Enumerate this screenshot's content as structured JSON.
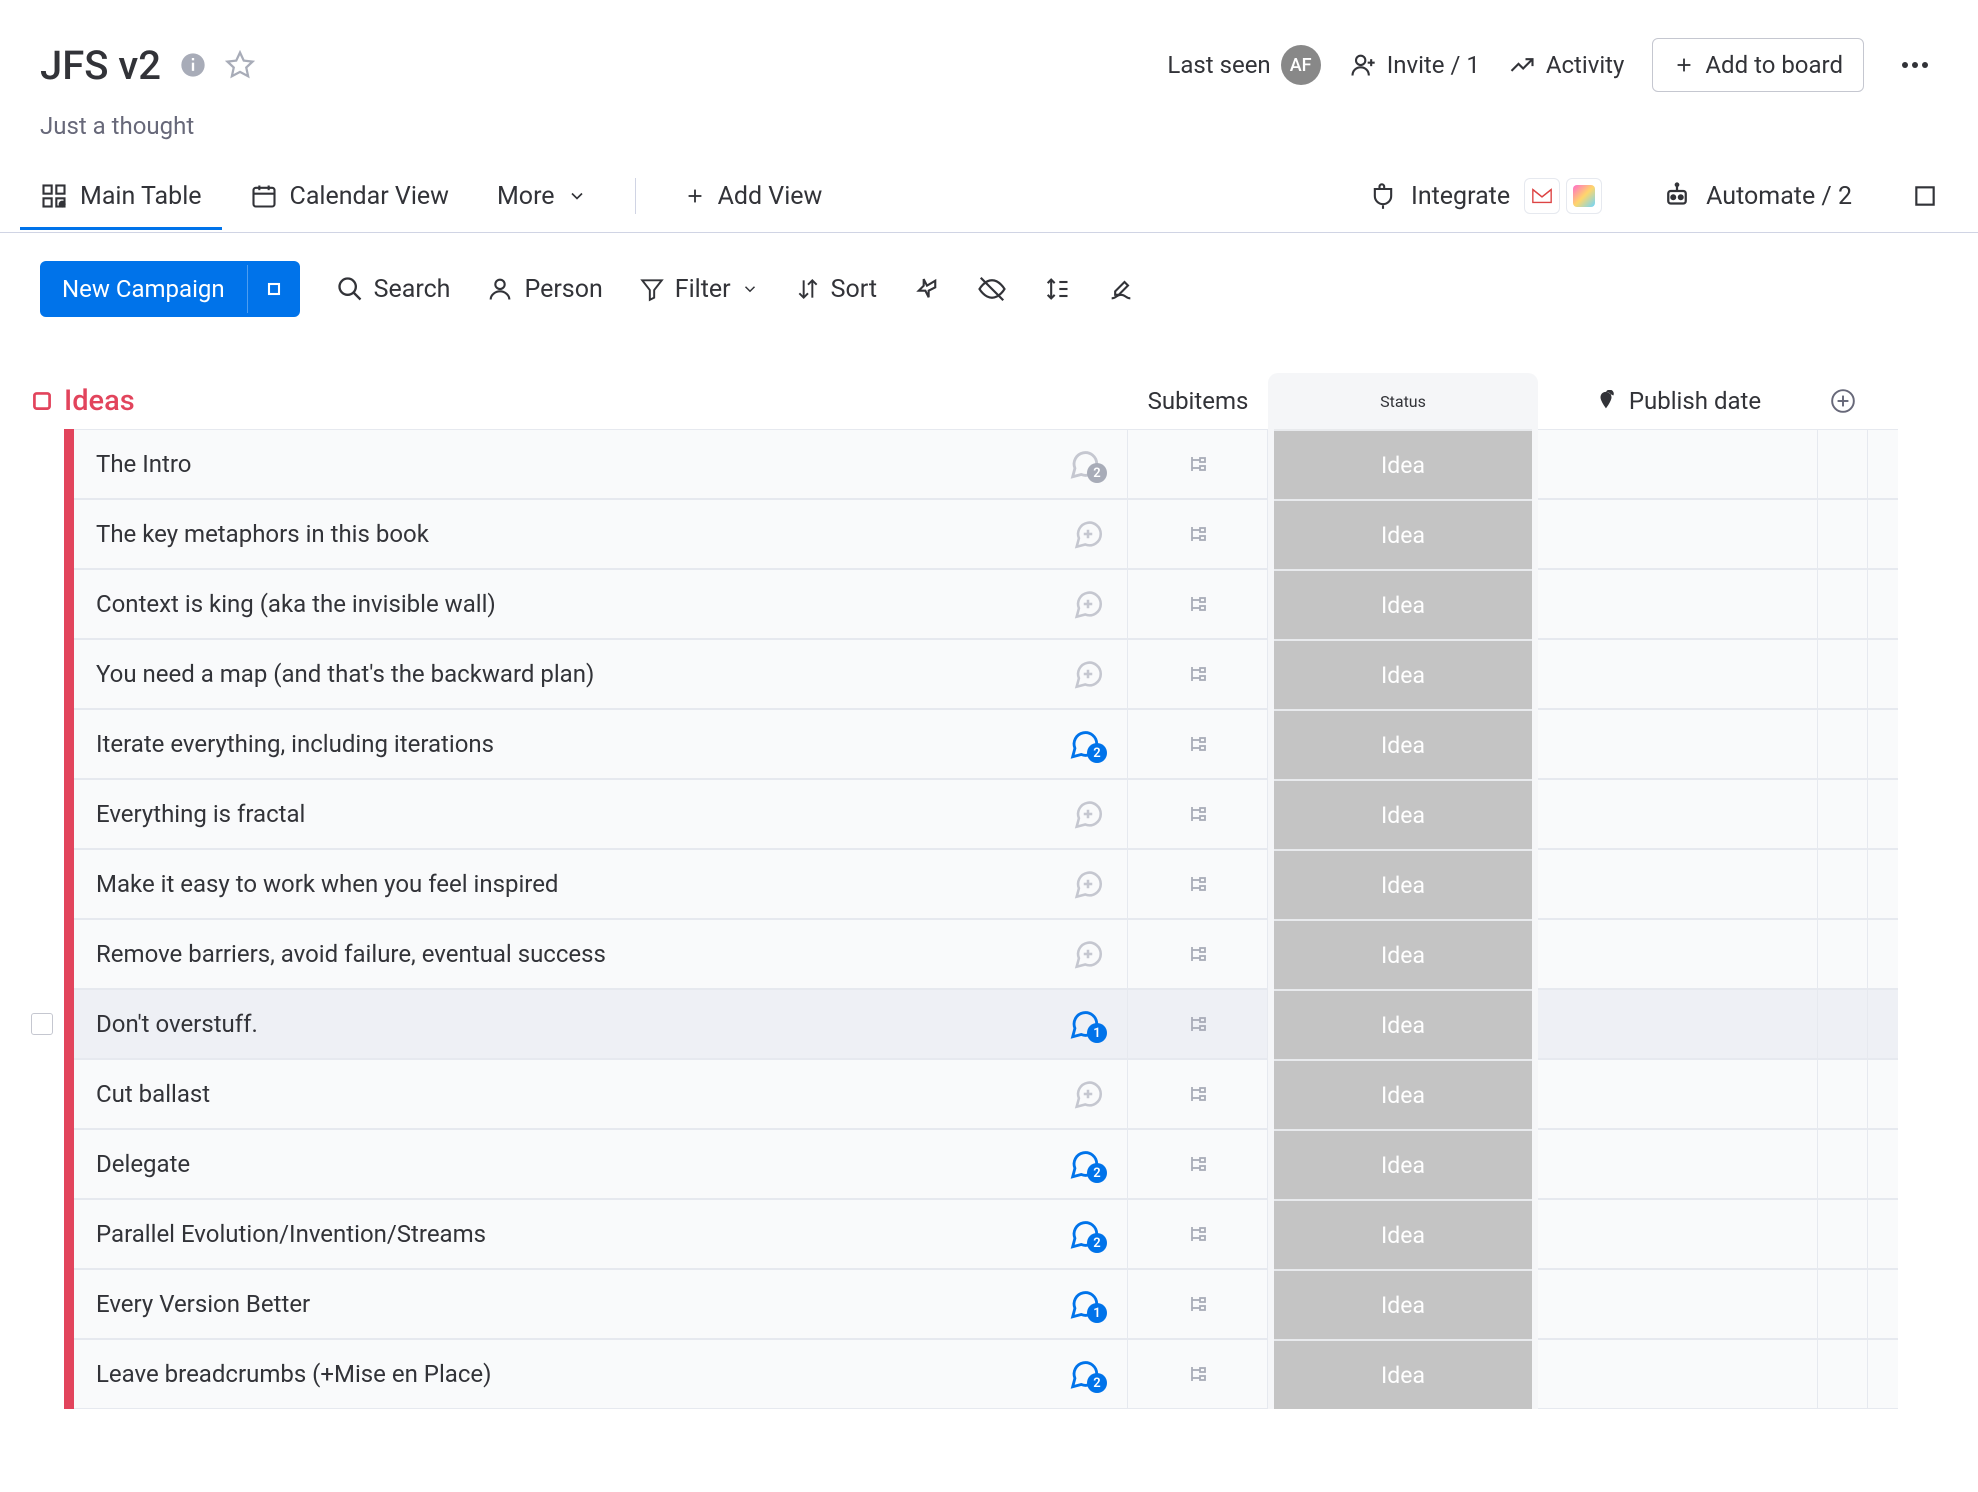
{
  "header": {
    "title": "JFS v2",
    "subtitle": "Just a thought",
    "last_seen": "Last seen",
    "avatar_initials": "AF",
    "invite": "Invite / 1",
    "activity": "Activity",
    "add_to_board": "Add to board"
  },
  "views": {
    "main_table": "Main Table",
    "calendar": "Calendar View",
    "more": "More",
    "add_view": "Add View",
    "integrate": "Integrate",
    "automate": "Automate / 2"
  },
  "toolbar": {
    "new_item": "New Campaign",
    "search": "Search",
    "person": "Person",
    "filter": "Filter",
    "sort": "Sort"
  },
  "group": {
    "title": "Ideas",
    "accent": "#e2445c",
    "columns": {
      "subitems": "Subitems",
      "status": "Status",
      "publish": "Publish date"
    },
    "rows": [
      {
        "name": "The Intro",
        "status": "Idea",
        "chat": "gray",
        "chat_count": 2
      },
      {
        "name": "The key metaphors in this book",
        "status": "Idea",
        "chat": "plus"
      },
      {
        "name": "Context is king (aka the invisible wall)",
        "status": "Idea",
        "chat": "plus"
      },
      {
        "name": "You need a map (and that's the backward plan)",
        "status": "Idea",
        "chat": "plus"
      },
      {
        "name": "Iterate everything, including iterations",
        "status": "Idea",
        "chat": "blue",
        "chat_count": 2
      },
      {
        "name": "Everything is fractal",
        "status": "Idea",
        "chat": "plus"
      },
      {
        "name": "Make it easy to work when you feel inspired",
        "status": "Idea",
        "chat": "plus"
      },
      {
        "name": "Remove barriers, avoid failure, eventual success",
        "status": "Idea",
        "chat": "plus"
      },
      {
        "name": "Don't overstuff.",
        "status": "Idea",
        "chat": "blue",
        "chat_count": 1,
        "hovered": true
      },
      {
        "name": "Cut ballast",
        "status": "Idea",
        "chat": "plus"
      },
      {
        "name": "Delegate",
        "status": "Idea",
        "chat": "blue",
        "chat_count": 2
      },
      {
        "name": "Parallel Evolution/Invention/Streams",
        "status": "Idea",
        "chat": "blue",
        "chat_count": 2
      },
      {
        "name": "Every Version Better",
        "status": "Idea",
        "chat": "blue",
        "chat_count": 1
      },
      {
        "name": "Leave breadcrumbs (+Mise en Place)",
        "status": "Idea",
        "chat": "blue",
        "chat_count": 2
      }
    ]
  },
  "colors": {
    "primary": "#0073ea",
    "pink": "#e2445c",
    "status_idea": "#c4c4c4"
  }
}
